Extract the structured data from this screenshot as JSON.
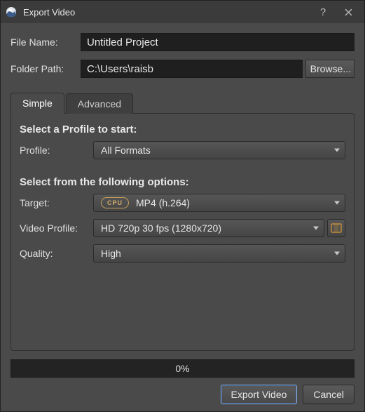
{
  "title": "Export Video",
  "fields": {
    "file_name_label": "File Name:",
    "file_name_value": "Untitled Project",
    "folder_path_label": "Folder Path:",
    "folder_path_value": "C:\\Users\\raisb",
    "browse_label": "Browse..."
  },
  "tabs": {
    "simple": "Simple",
    "advanced": "Advanced"
  },
  "panel": {
    "profile_heading": "Select a Profile to start:",
    "profile_label": "Profile:",
    "profile_value": "All Formats",
    "options_heading": "Select from the following options:",
    "target_label": "Target:",
    "target_badge": "CPU",
    "target_value": "MP4 (h.264)",
    "video_profile_label": "Video Profile:",
    "video_profile_value": "HD 720p 30 fps (1280x720)",
    "quality_label": "Quality:",
    "quality_value": "High"
  },
  "progress_text": "0%",
  "footer": {
    "export_label": "Export Video",
    "cancel_label": "Cancel"
  }
}
